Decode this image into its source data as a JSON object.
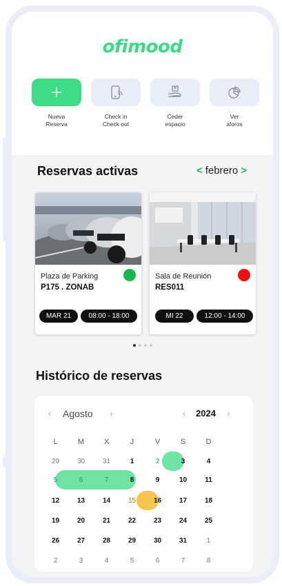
{
  "app": {
    "logo": "ofimood"
  },
  "actions": [
    {
      "label": "Nueva\nReserva",
      "icon": "plus-icon"
    },
    {
      "label": "Check  in\nCheck out",
      "icon": "phone-nfc-icon"
    },
    {
      "label": "Ceder\nespacio",
      "icon": "hand-box-icon"
    },
    {
      "label": "Ver\naforos",
      "icon": "pie-chart-icon"
    }
  ],
  "active": {
    "title": "Reservas activas",
    "month": "febrero",
    "prev": "<",
    "next": ">",
    "cards": [
      {
        "place": "Plaza de Parking",
        "code": "P175 . ZONAB",
        "date": "MAR 21",
        "time": "08:00 - 18:00",
        "status_color": "#1ab54b"
      },
      {
        "place": "Sala de Reunión",
        "code": "RES011",
        "date": "MI 22",
        "time": "12:00 - 14:00",
        "status_color": "#ee1111"
      }
    ]
  },
  "history": {
    "title": "Histórico de reservas",
    "calendar": {
      "month": "Agosto",
      "year": "2024",
      "weekdays": [
        "L",
        "M",
        "X",
        "J",
        "V",
        "S",
        "D"
      ],
      "weeks": [
        [
          "29",
          "30",
          "31",
          "1",
          "2",
          "3",
          "4"
        ],
        [
          "5",
          "6",
          "7",
          "8",
          "9",
          "10",
          "11"
        ],
        [
          "12",
          "13",
          "14",
          "15",
          "16",
          "17",
          "18"
        ],
        [
          "19",
          "20",
          "21",
          "22",
          "23",
          "24",
          "25"
        ],
        [
          "26",
          "27",
          "28",
          "29",
          "30",
          "31",
          "1"
        ],
        [
          "2",
          "3",
          "4",
          "5",
          "6",
          "7",
          "8"
        ]
      ],
      "highlight_green": [
        "2",
        "5",
        "6",
        "7"
      ],
      "highlight_orange": [
        "15"
      ],
      "colors": {
        "green": "#6ee3a2",
        "orange": "#f7c54c"
      }
    }
  }
}
